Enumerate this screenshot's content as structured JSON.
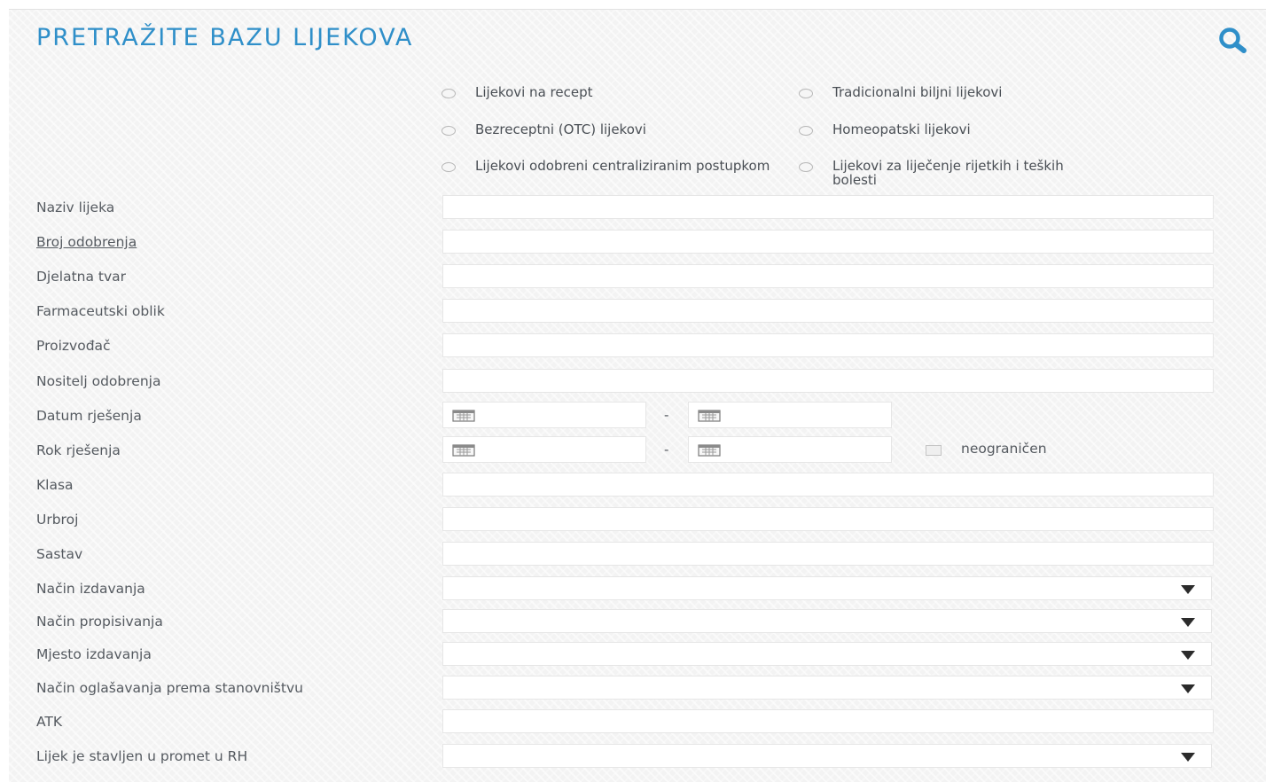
{
  "form": {
    "title": "PRETRAŽITE BAZU LIJEKOVA",
    "search_icon": "search-icon",
    "accent_color": "#2f8fc9"
  },
  "medicine_types": [
    {
      "label": "Lijekovi na recept"
    },
    {
      "label": "Tradicionalni biljni lijekovi"
    },
    {
      "label": "Bezreceptni (OTC) lijekovi"
    },
    {
      "label": "Homeopatski lijekovi"
    },
    {
      "label": "Lijekovi odobreni centraliziranim postupkom"
    },
    {
      "label": "Lijekovi za liječenje rijetkih i teških bolesti"
    }
  ],
  "fields": {
    "naziv": {
      "label": "Naziv lijeka",
      "value": ""
    },
    "broj": {
      "label": "Broj odobrenja",
      "value": ""
    },
    "djelatna": {
      "label": "Djelatna tvar",
      "value": ""
    },
    "oblik": {
      "label": "Farmaceutski oblik",
      "value": ""
    },
    "proizvodac": {
      "label": "Proizvođač",
      "value": ""
    },
    "nositelj": {
      "label": "Nositelj odobrenja",
      "value": ""
    },
    "datum": {
      "label": "Datum rješenja",
      "separator": "-",
      "from": "",
      "to": ""
    },
    "rok": {
      "label": "Rok rješenja",
      "separator": "-",
      "from": "",
      "to": "",
      "checkbox_label": "neograničen"
    },
    "klasa": {
      "label": "Klasa",
      "value": ""
    },
    "urbroj": {
      "label": "Urbroj",
      "value": ""
    },
    "sastav": {
      "label": "Sastav",
      "value": ""
    },
    "izdavanje": {
      "label": "Način izdavanja",
      "selected": ""
    },
    "propisivanje": {
      "label": "Način propisivanja",
      "selected": ""
    },
    "mjesto": {
      "label": "Mjesto izdavanja",
      "selected": ""
    },
    "oglasavanje": {
      "label": "Način oglašavanja prema stanovništvu",
      "selected": ""
    },
    "atk": {
      "label": "ATK",
      "value": ""
    },
    "promet": {
      "label": "Lijek je stavljen u promet u RH",
      "selected": ""
    }
  }
}
